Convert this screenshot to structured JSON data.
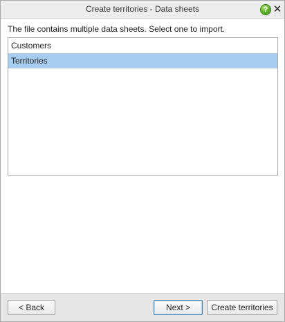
{
  "window": {
    "title": "Create territories - Data sheets",
    "help_icon": "help-icon",
    "help_label": "?",
    "close_icon": "close-icon",
    "close_label": "✕"
  },
  "content": {
    "instruction": "The file contains multiple data sheets. Select one to import.",
    "sheets": [
      {
        "label": "Customers",
        "selected": false
      },
      {
        "label": "Territories",
        "selected": true
      }
    ]
  },
  "footer": {
    "back_label": "< Back",
    "next_label": "Next >",
    "create_label": "Create territories"
  },
  "colors": {
    "selection": "#a7cdf0",
    "help_green": "#5bb127",
    "footer_bg": "#e6e6e6"
  }
}
